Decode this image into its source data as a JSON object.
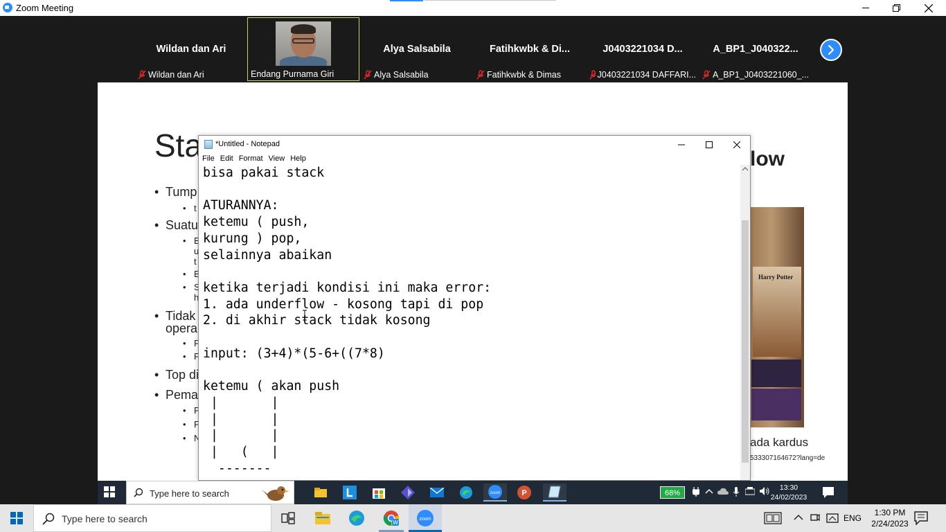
{
  "zoom": {
    "window_title": "Zoom Meeting",
    "participants": [
      {
        "display_name": "Wildan dan Ari",
        "label": "Wildan dan Ari",
        "muted": true,
        "video": false
      },
      {
        "display_name": "",
        "label": "Endang Purnama Giri",
        "muted": false,
        "video": true,
        "active": true
      },
      {
        "display_name": "Alya Salsabila",
        "label": "Alya Salsabila",
        "muted": true,
        "video": false
      },
      {
        "display_name": "Fatihkwbk & Di...",
        "label": "Fatihkwbk & Dimas",
        "muted": true,
        "video": false
      },
      {
        "display_name": "J0403221034 D...",
        "label": "J0403221034 DAFFARI...",
        "muted": true,
        "video": false
      },
      {
        "display_name": "A_BP1_J040322...",
        "label": "A_BP1_J0403221060_...",
        "muted": true,
        "video": false
      }
    ]
  },
  "slide": {
    "title": "Sta",
    "right_title": "low",
    "bullets": [
      {
        "level": 1,
        "text": "Tump"
      },
      {
        "level": 2,
        "text": "t"
      },
      {
        "level": 1,
        "text": "Suatu"
      },
      {
        "level": 2,
        "text": "B"
      },
      {
        "level": 2,
        "text": "u"
      },
      {
        "level": 2,
        "text": "t"
      },
      {
        "level": 2,
        "text": "B"
      },
      {
        "level": 2,
        "text": "S"
      },
      {
        "level": 2,
        "text": "h"
      },
      {
        "level": 1,
        "text": "Tidak"
      },
      {
        "level": 1,
        "text": "opera"
      },
      {
        "level": 2,
        "text": "P"
      },
      {
        "level": 2,
        "text": "P"
      },
      {
        "level": 1,
        "text": "Top di"
      },
      {
        "level": 1,
        "text": "Pema"
      },
      {
        "level": 2,
        "text": "P"
      },
      {
        "level": 2,
        "text": "P"
      },
      {
        "level": 2,
        "text": "N"
      }
    ],
    "book_text": "Harry Potter",
    "caption": "ada kardus",
    "url_fragment": "533307164672?lang=de"
  },
  "notepad": {
    "title": "*Untitled - Notepad",
    "menu": [
      "File",
      "Edit",
      "Format",
      "View",
      "Help"
    ],
    "content": "bisa pakai stack\n\nATURANNYA:\nketemu ( push,\nkurung ) pop,\nselainnya abaikan\n\nketika terjadi kondisi ini maka error:\n1. ada underflow - kosong tapi di pop\n2. di akhir stack tidak kosong\n\ninput: (3+4)*(5-6+((7*8)\n\nketemu ( akan push\n |       |\n |       |\n |       |\n |   (   |\n  -------"
  },
  "inner_taskbar": {
    "search_placeholder": "Type here to search",
    "battery": "68%",
    "time": "13:30",
    "date": "24/02/2023"
  },
  "taskbar": {
    "search_placeholder": "Type here to search",
    "language": "ENG",
    "time": "1:30 PM",
    "date": "2/24/2023"
  },
  "colors": {
    "zoom_blue": "#2d8cff",
    "gallery_bg": "#1a1a1a",
    "active_speaker_border": "#c9d26b",
    "mute_red": "#e02828"
  }
}
